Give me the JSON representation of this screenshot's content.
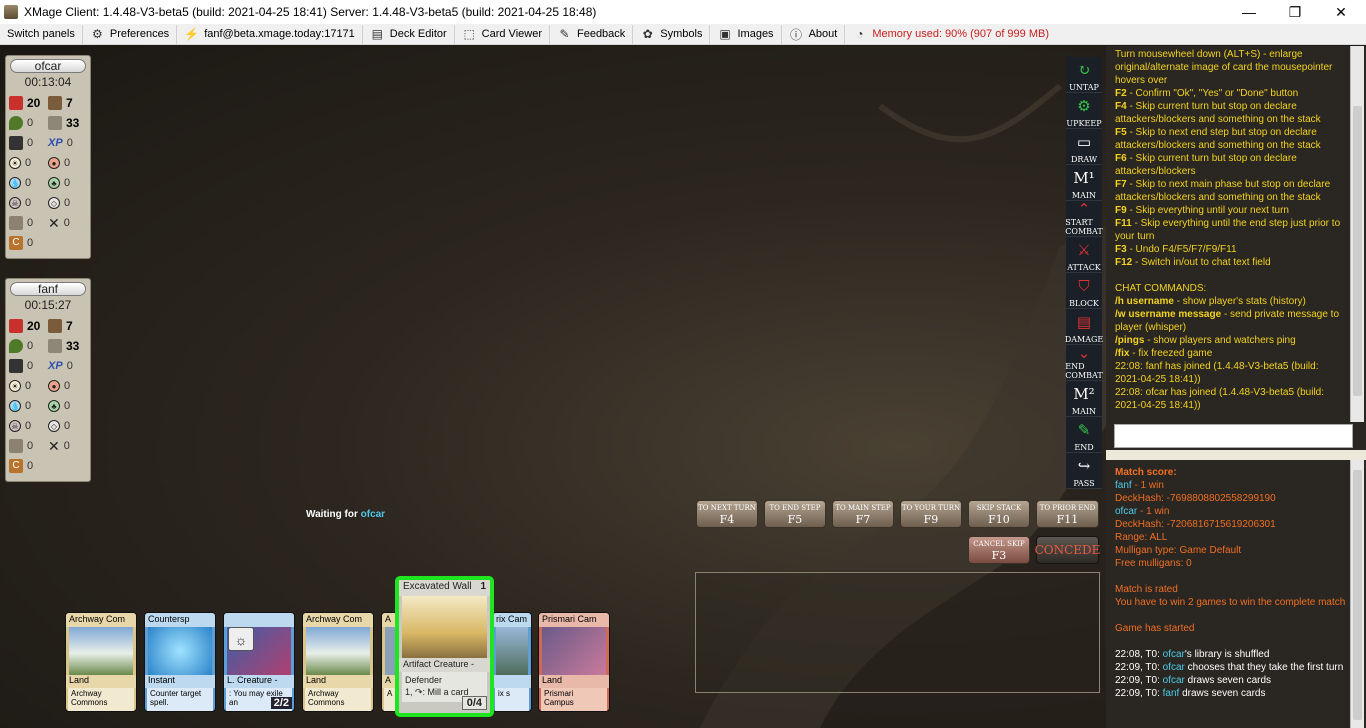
{
  "window": {
    "title": "XMage  Client: 1.4.48-V3-beta5 (build: 2021-04-25 18:41)  Server: 1.4.48-V3-beta5 (build: 2021-04-25 18:48)",
    "minimize": "—",
    "maximize": "❐",
    "close": "✕"
  },
  "menu": {
    "switch_panels": "Switch panels",
    "preferences": "Preferences",
    "server": "fanf@beta.xmage.today:17171",
    "deck_editor": "Deck Editor",
    "card_viewer": "Card Viewer",
    "feedback": "Feedback",
    "symbols": "Symbols",
    "images": "Images",
    "about": "About",
    "memory": "Memory used: 90% (907 of 999 MB)"
  },
  "players": [
    {
      "name": "ofcar",
      "time": "00:13:04",
      "life": "20",
      "hand": "7",
      "poison": "0",
      "library": "33",
      "energy": "0",
      "experience": "0",
      "white": "0",
      "red": "0",
      "blue": "0",
      "green": "0",
      "black": "0",
      "colorless": "0",
      "graveyard": "0",
      "exile": "0",
      "command": "0"
    },
    {
      "name": "fanf",
      "time": "00:15:27",
      "life": "20",
      "hand": "7",
      "poison": "0",
      "library": "33",
      "energy": "0",
      "experience": "0",
      "white": "0",
      "red": "0",
      "blue": "0",
      "green": "0",
      "black": "0",
      "colorless": "0",
      "graveyard": "0",
      "exile": "0",
      "command": "0"
    }
  ],
  "phases": [
    "UNTAP",
    "UPKEEP",
    "DRAW",
    "MAIN",
    "START COMBAT",
    "ATTACK",
    "BLOCK",
    "DAMAGE",
    "END COMBAT",
    "MAIN",
    "END",
    "PASS"
  ],
  "skip_buttons": [
    {
      "label": "TO NEXT TURN",
      "key": "F4"
    },
    {
      "label": "TO END STEP",
      "key": "F5"
    },
    {
      "label": "TO MAIN STEP",
      "key": "F7"
    },
    {
      "label": "TO YOUR TURN",
      "key": "F9"
    },
    {
      "label": "SKIP STACK",
      "key": "F10"
    },
    {
      "label": "TO PRIOR END",
      "key": "F11"
    },
    {
      "label": "CANCEL SKIP",
      "key": "F3"
    }
  ],
  "concede": "CONCEDE",
  "waiting": {
    "prefix": "Waiting for ",
    "name": "ofcar"
  },
  "hand": [
    {
      "title": "Archway Com",
      "type": "Land",
      "text": "Archway Commons",
      "color": "land"
    },
    {
      "title": "Countersp",
      "type": "Instant",
      "text": "Counter target spell.",
      "color": "blue"
    },
    {
      "title": "",
      "type": "L. Creature -",
      "text": ": You may exile an",
      "pt": "2/2",
      "color": "blue"
    },
    {
      "title": "Archway Com",
      "type": "Land",
      "text": "Archway Commons",
      "color": "land"
    },
    {
      "title": "A",
      "type": "A",
      "text": "A",
      "color": "land"
    },
    {
      "title": "rix Cam",
      "type": "",
      "text": "ix s",
      "color": "blue"
    },
    {
      "title": "Prismari Cam",
      "type": "Land",
      "text": "Prismari Campus",
      "color": "red"
    }
  ],
  "highlight_card": {
    "title": "Excavated Wall",
    "cost": "1",
    "type": "Artifact Creature -",
    "text1": "Defender",
    "text2": "1, ↷: Mill a card",
    "pt": "0/4"
  },
  "help_lines": [
    {
      "k": "",
      "t": "Turn mousewheel down (ALT+S) - enlarge original/alternate image of card the mousepointer hovers over"
    },
    {
      "k": "F2",
      "t": " - Confirm \"Ok\", \"Yes\" or \"Done\" button"
    },
    {
      "k": "F4",
      "t": " - Skip current turn but stop on declare attackers/blockers and something on the stack"
    },
    {
      "k": "F5",
      "t": " - Skip to next end step but stop on declare attackers/blockers and something on the stack"
    },
    {
      "k": "F6",
      "t": " - Skip current turn but stop on declare attackers/blockers"
    },
    {
      "k": "F7",
      "t": " - Skip to next main phase but stop on declare attackers/blockers and something on the stack"
    },
    {
      "k": "F9",
      "t": " - Skip everything until your next turn"
    },
    {
      "k": "F11",
      "t": " - Skip everything until the end step just prior to your turn"
    },
    {
      "k": "F3",
      "t": " - Undo F4/F5/F7/F9/F11"
    },
    {
      "k": "F12",
      "t": " - Switch in/out to chat text field"
    }
  ],
  "chat_header": "CHAT COMMANDS:",
  "chat_cmds": [
    {
      "k": "/h username",
      "t": " - show player's stats (history)"
    },
    {
      "k": "/w username message",
      "t": " - send private message to player (whisper)"
    },
    {
      "k": "/pings",
      "t": " - show players and watchers ping"
    },
    {
      "k": "/fix",
      "t": " - fix freezed game"
    }
  ],
  "chat_joins": [
    "22:08: fanf has joined (1.4.48-V3-beta5 (build: 2021-04-25 18:41))",
    "22:08: ofcar has joined (1.4.48-V3-beta5 (build: 2021-04-25 18:41))"
  ],
  "log": {
    "match_score": "Match score:",
    "p1": "fanf",
    "p1_wins": " - 1 win",
    "hash1": "DeckHash: -7698808802558299190",
    "p2": "ofcar",
    "p2_wins": " - 1 win",
    "hash2": "DeckHash: -7206816715619206301",
    "range": "Range: ALL",
    "mulligan": "Mulligan type: Game Default",
    "free": "Free mulligans: 0",
    "rated": "Match is rated",
    "win2": "You have to win 2 games to win the complete match",
    "started": "Game has started",
    "e1a": "22:08, T0: ",
    "e1b": "ofcar",
    "e1c": "'s library is shuffled",
    "e2a": "22:09, T0: ",
    "e2b": "ofcar",
    "e2c": " chooses that they take the first turn",
    "e3a": "22:09, T0: ",
    "e3b": "ofcar",
    "e3c": " draws seven cards",
    "e4a": "22:09, T0: ",
    "e4b": "fanf",
    "e4c": " draws seven cards"
  }
}
